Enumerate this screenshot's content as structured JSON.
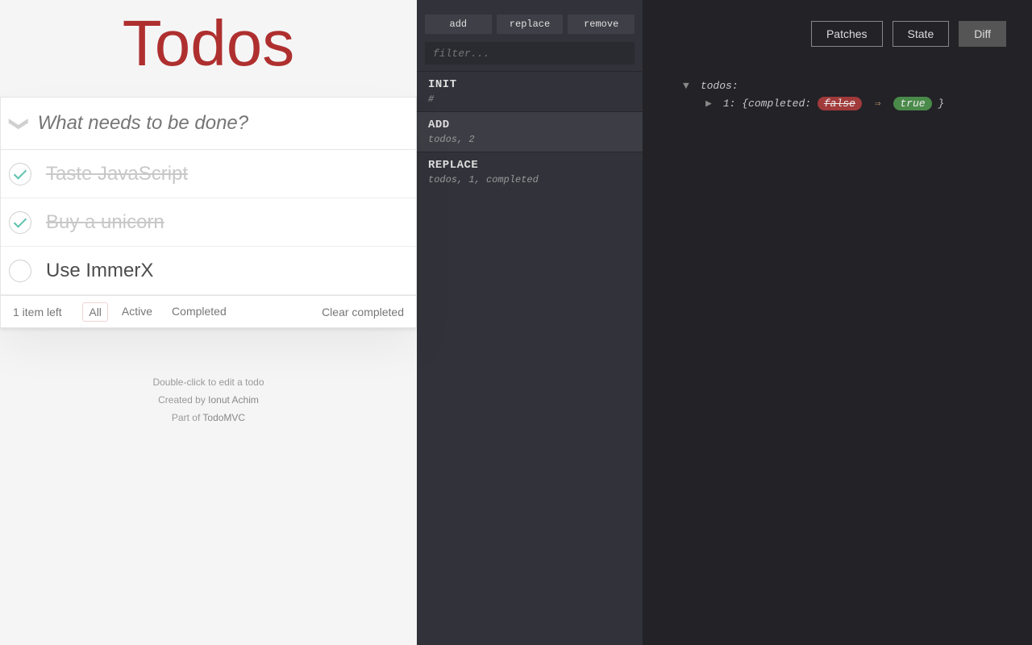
{
  "todo": {
    "title": "Todos",
    "new_placeholder": "What needs to be done?",
    "items": [
      {
        "label": "Taste JavaScript",
        "done": true
      },
      {
        "label": "Buy a unicorn",
        "done": true
      },
      {
        "label": "Use ImmerX",
        "done": false
      }
    ],
    "count_text": "1 item left",
    "filters": {
      "all": "All",
      "active": "Active",
      "completed": "Completed",
      "selected": "all"
    },
    "clear": "Clear completed",
    "info": {
      "line1": "Double-click to edit a todo",
      "line2_prefix": "Created by ",
      "line2_author": "Ionut Achim",
      "line3_prefix": "Part of ",
      "line3_link": "TodoMVC"
    }
  },
  "log": {
    "actions": {
      "add": "add",
      "replace": "replace",
      "remove": "remove"
    },
    "filter_placeholder": "filter...",
    "entries": [
      {
        "op": "INIT",
        "path": "#",
        "selected": false
      },
      {
        "op": "ADD",
        "path": "todos, 2",
        "selected": true
      },
      {
        "op": "REPLACE",
        "path": "todos, 1, completed",
        "selected": false
      }
    ]
  },
  "dev": {
    "tabs": {
      "patches": "Patches",
      "state": "State",
      "diff": "Diff",
      "active": "diff"
    },
    "tree": {
      "root_key": "todos",
      "child_key": "1",
      "field": "completed",
      "old": "false",
      "new": "true"
    }
  }
}
